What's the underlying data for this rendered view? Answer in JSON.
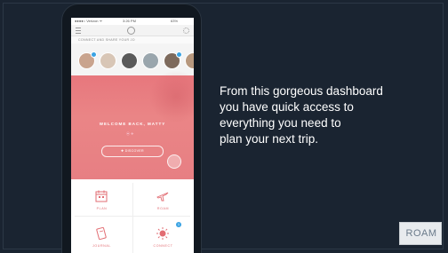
{
  "status_bar": {
    "carrier": "●●●●○ Verizon ᯤ",
    "time": "3:26 PM",
    "battery": "63%"
  },
  "connect_header": "CONNECT AND SHARE YOUR JO",
  "avatars": [
    {
      "name": "avatar-1",
      "color": "#c9a48e",
      "badge": true
    },
    {
      "name": "avatar-2",
      "color": "#d8c6b6",
      "badge": false
    },
    {
      "name": "avatar-3",
      "color": "#5a5a5a",
      "badge": false
    },
    {
      "name": "avatar-4",
      "color": "#9aa6ad",
      "badge": false
    },
    {
      "name": "avatar-5",
      "color": "#7d6a5c",
      "badge": true
    }
  ],
  "hero": {
    "welcome": "WELCOME BACK, MATTY",
    "icons": "⦿  ✈",
    "discover_label": "✚   DISCOVER"
  },
  "tiles": [
    {
      "label": "PLAN",
      "icon": "calendar-icon"
    },
    {
      "label": "ROAM",
      "icon": "airplane-icon"
    },
    {
      "label": "JOURNAL",
      "icon": "journal-icon"
    },
    {
      "label": "CONNECT",
      "icon": "connect-icon",
      "badge": "1"
    }
  ],
  "caption_lines": [
    "From this gorgeous dashboard",
    "you have quick access to",
    "everything you need to",
    "plan your next trip."
  ],
  "watermark": "ROAM",
  "colors": {
    "background": "#1a2431",
    "accent": "#e26d73",
    "badge": "#3aa3e3"
  }
}
